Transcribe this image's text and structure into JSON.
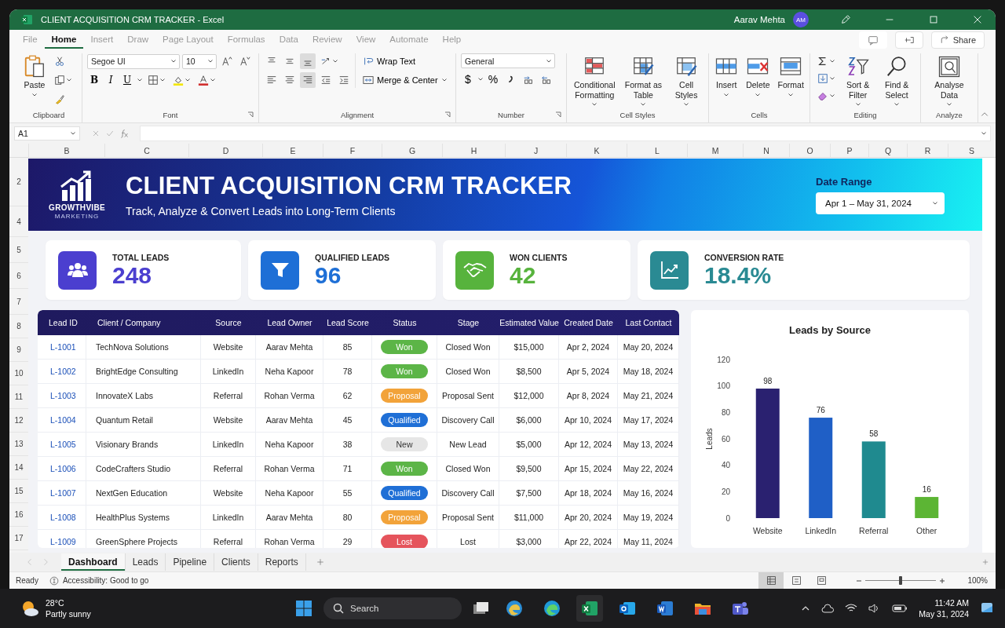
{
  "window": {
    "title": "CLIENT ACQUISITION CRM TRACKER - Excel",
    "user": "Aarav Mehta",
    "avatar": "AM"
  },
  "ribbon_tabs": [
    {
      "label": "File",
      "selected": false
    },
    {
      "label": "Home",
      "selected": true
    },
    {
      "label": "Insert",
      "selected": false
    },
    {
      "label": "Draw",
      "selected": false
    },
    {
      "label": "Page Layout",
      "selected": false
    },
    {
      "label": "Formulas",
      "selected": false
    },
    {
      "label": "Data",
      "selected": false
    },
    {
      "label": "Review",
      "selected": false
    },
    {
      "label": "View",
      "selected": false
    },
    {
      "label": "Automate",
      "selected": false
    },
    {
      "label": "Help",
      "selected": false
    }
  ],
  "share": "Share",
  "ribbon": {
    "clipboard": {
      "label": "Clipboard",
      "paste": "Paste"
    },
    "font": {
      "label": "Font",
      "family": "Segoe UI",
      "size": "10",
      "bold": "B",
      "italic": "I",
      "underline": "U"
    },
    "alignment": {
      "label": "Alignment",
      "wrap": "Wrap Text",
      "merge": "Merge & Center",
      "align_buttons": [
        {
          "kind": "top",
          "selected": false
        },
        {
          "kind": "middle",
          "selected": false
        },
        {
          "kind": "bottom",
          "selected": true
        },
        {
          "kind": "left",
          "selected": false
        },
        {
          "kind": "center",
          "selected": false
        },
        {
          "kind": "right",
          "selected": true
        }
      ]
    },
    "number": {
      "label": "Number",
      "format": "General",
      "currency": "$",
      "percent": "%"
    },
    "styles": {
      "label": "Cell Styles",
      "buttons": [
        {
          "kind": "conditional",
          "label": "Conditional Formatting"
        },
        {
          "kind": "table",
          "label": "Format as Table"
        },
        {
          "kind": "styles",
          "label": "Cell Styles"
        }
      ]
    },
    "cells": {
      "label": "Cells",
      "buttons": [
        {
          "kind": "insert",
          "label": "Insert"
        },
        {
          "kind": "delete",
          "label": "Delete"
        },
        {
          "kind": "format",
          "label": "Format"
        }
      ]
    },
    "editing": {
      "label": "Editing",
      "buttons": [
        {
          "kind": "sort",
          "label": "Sort & Filter"
        },
        {
          "kind": "find",
          "label": "Find & Select"
        }
      ]
    },
    "analyze": {
      "label": "Analyze",
      "buttons": [
        {
          "kind": "analyze",
          "label": "Analyse Data"
        }
      ]
    }
  },
  "name_box": "A1",
  "columns": [
    "B",
    "C",
    "D",
    "E",
    "F",
    "G",
    "H",
    "J",
    "K",
    "L",
    "M",
    "N",
    "O",
    "P",
    "Q",
    "R",
    "S"
  ],
  "rows": [
    "2",
    "4",
    "5",
    "6",
    "7",
    "8",
    "9",
    "10",
    "11",
    "12",
    "13",
    "14",
    "15",
    "16",
    "17"
  ],
  "banner": {
    "logo": "GROWTHVIBE",
    "logo_sub": "MARKETING",
    "title": "CLIENT ACQUISITION CRM TRACKER",
    "subtitle": "Track, Analyze & Convert Leads into Long-Term Clients",
    "date_range_label": "Date Range",
    "date_range": "Apr 1 – May 31, 2024"
  },
  "kpis": [
    {
      "kind": "people",
      "label": "TOTAL LEADS",
      "value": "248",
      "color": "#4b3fcf"
    },
    {
      "kind": "funnel",
      "label": "QUALIFIED LEADS",
      "value": "96",
      "color": "#1e6fd6"
    },
    {
      "kind": "handshake",
      "label": "WON CLIENTS",
      "value": "42",
      "color": "#57b33d"
    },
    {
      "kind": "trend",
      "label": "CONVERSION RATE",
      "value": "18.4%",
      "color": "#2a8a93"
    }
  ],
  "leads": {
    "columns": [
      "Lead ID",
      "Client / Company",
      "Source",
      "Lead Owner",
      "Lead Score",
      "Status",
      "Stage",
      "Estimated Value",
      "Created Date",
      "Last Contact"
    ],
    "rows": [
      {
        "id": "L-1001",
        "client": "TechNova Solutions",
        "source": "Website",
        "owner": "Aarav Mehta",
        "score": "85",
        "status": {
          "label": "Won",
          "color": "#5cb547"
        },
        "stage": "Closed Won",
        "value": "$15,000",
        "created": "Apr 2, 2024",
        "last_contact": "May 20, 2024"
      },
      {
        "id": "L-1002",
        "client": "BrightEdge Consulting",
        "source": "LinkedIn",
        "owner": "Neha Kapoor",
        "score": "78",
        "status": {
          "label": "Won",
          "color": "#5cb547"
        },
        "stage": "Closed Won",
        "value": "$8,500",
        "created": "Apr 5, 2024",
        "last_contact": "May 18, 2024"
      },
      {
        "id": "L-1003",
        "client": "InnovateX Labs",
        "source": "Referral",
        "owner": "Rohan Verma",
        "score": "62",
        "status": {
          "label": "Proposal",
          "color": "#f2a33a"
        },
        "stage": "Proposal Sent",
        "value": "$12,000",
        "created": "Apr 8, 2024",
        "last_contact": "May 21, 2024"
      },
      {
        "id": "L-1004",
        "client": "Quantum Retail",
        "source": "Website",
        "owner": "Aarav Mehta",
        "score": "45",
        "status": {
          "label": "Qualified",
          "color": "#1f6fd6"
        },
        "stage": "Discovery Call",
        "value": "$6,000",
        "created": "Apr 10, 2024",
        "last_contact": "May 17, 2024"
      },
      {
        "id": "L-1005",
        "client": "Visionary Brands",
        "source": "LinkedIn",
        "owner": "Neha Kapoor",
        "score": "38",
        "status": {
          "label": "New",
          "color": "#e6e6e6"
        },
        "stage": "New Lead",
        "value": "$5,000",
        "created": "Apr 12, 2024",
        "last_contact": "May 13, 2024"
      },
      {
        "id": "L-1006",
        "client": "CodeCrafters Studio",
        "source": "Referral",
        "owner": "Rohan Verma",
        "score": "71",
        "status": {
          "label": "Won",
          "color": "#5cb547"
        },
        "stage": "Closed Won",
        "value": "$9,500",
        "created": "Apr 15, 2024",
        "last_contact": "May 22, 2024"
      },
      {
        "id": "L-1007",
        "client": "NextGen Education",
        "source": "Website",
        "owner": "Neha Kapoor",
        "score": "55",
        "status": {
          "label": "Qualified",
          "color": "#1f6fd6"
        },
        "stage": "Discovery Call",
        "value": "$7,500",
        "created": "Apr 18, 2024",
        "last_contact": "May 16, 2024"
      },
      {
        "id": "L-1008",
        "client": "HealthPlus Systems",
        "source": "LinkedIn",
        "owner": "Aarav Mehta",
        "score": "80",
        "status": {
          "label": "Proposal",
          "color": "#f2a33a"
        },
        "stage": "Proposal Sent",
        "value": "$11,000",
        "created": "Apr 20, 2024",
        "last_contact": "May 19, 2024"
      },
      {
        "id": "L-1009",
        "client": "GreenSphere Projects",
        "source": "Referral",
        "owner": "Rohan Verma",
        "score": "29",
        "status": {
          "label": "Lost",
          "color": "#e5545c"
        },
        "stage": "Lost",
        "value": "$3,000",
        "created": "Apr 22, 2024",
        "last_contact": "May 11, 2024"
      }
    ]
  },
  "chart": {
    "chart_data": {
      "type": "bar",
      "title": "Leads by Source",
      "ylabel": "Leads",
      "categories": [
        "Website",
        "LinkedIn",
        "Referral",
        "Other"
      ],
      "series": [
        {
          "values": [
            98,
            76,
            58,
            16
          ]
        }
      ],
      "colors": [
        "#2a2170",
        "#1f5fc6",
        "#1f8a8f",
        "#5cb534"
      ],
      "ylim": [
        0,
        120
      ],
      "yticks": [
        0,
        20,
        40,
        60,
        80,
        100,
        120
      ],
      "data_labels": true
    }
  },
  "sheet_tabs": [
    {
      "label": "Dashboard",
      "selected": true
    },
    {
      "label": "Leads",
      "selected": false
    },
    {
      "label": "Pipeline",
      "selected": false
    },
    {
      "label": "Clients",
      "selected": false
    },
    {
      "label": "Reports",
      "selected": false
    }
  ],
  "status_bar": {
    "ready": "Ready",
    "accessibility": "Accessibility: Good to go",
    "views": [
      {
        "kind": "normal",
        "selected": true
      },
      {
        "kind": "layout",
        "selected": false
      },
      {
        "kind": "break",
        "selected": false
      }
    ],
    "zoom": {
      "level": 0.5
    },
    "zoom_text": "100%"
  },
  "taskbar": {
    "weather_temp": "28°C",
    "weather_text": "Partly sunny",
    "search": "Search",
    "apps": [
      {
        "kind": "edge-beta",
        "selected": false
      },
      {
        "kind": "edge",
        "selected": false
      },
      {
        "kind": "excel",
        "selected": true
      },
      {
        "kind": "outlook",
        "selected": false
      },
      {
        "kind": "word",
        "selected": false
      },
      {
        "kind": "folder",
        "selected": false
      },
      {
        "kind": "teams",
        "selected": false
      }
    ],
    "time": "11:42 AM",
    "date": "May 31, 2024"
  }
}
